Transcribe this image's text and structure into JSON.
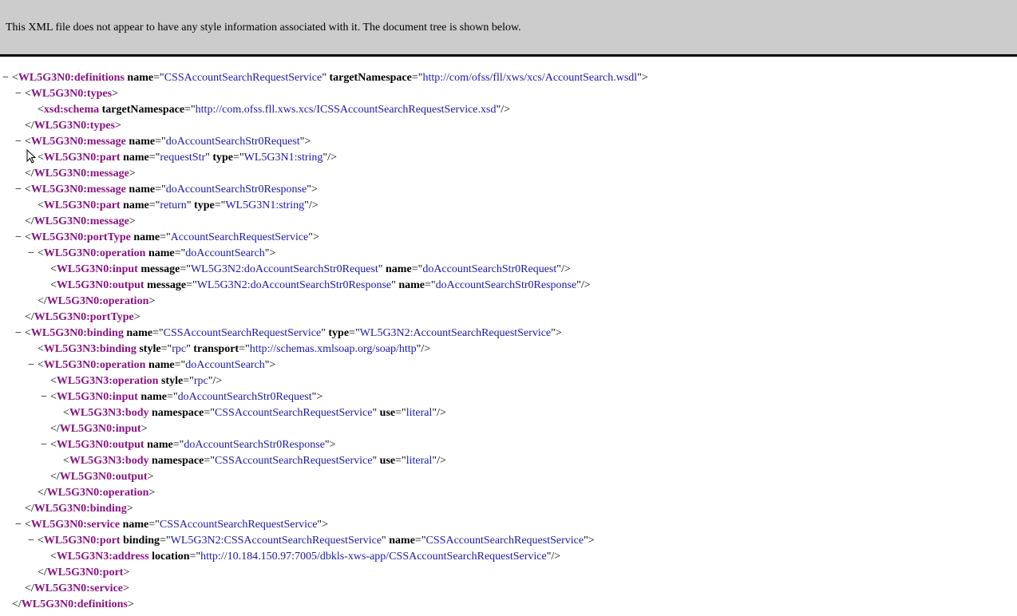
{
  "banner": {
    "message": "This XML file does not appear to have any style information associated with it. The document tree is shown below."
  },
  "colors": {
    "tag": "#881280",
    "attribute_value": "#1a1aa6",
    "banner_bg": "#cccccc"
  },
  "collapse_glyph": "−",
  "lines": [
    {
      "indent": 0,
      "toggle": true,
      "type": "open",
      "tag": "WL5G3N0:definitions",
      "attrs": [
        [
          "name",
          "CSSAccountSearchRequestService"
        ],
        [
          "targetNamespace",
          "http://com/ofss/fll/xws/xcs/AccountSearch.wsdl"
        ]
      ]
    },
    {
      "indent": 1,
      "toggle": true,
      "type": "open",
      "tag": "WL5G3N0:types",
      "attrs": []
    },
    {
      "indent": 2,
      "toggle": false,
      "type": "empty",
      "tag": "xsd:schema",
      "attrs": [
        [
          "targetNamespace",
          "http://com.ofss.fll.xws.xcs/ICSSAccountSearchRequestService.xsd"
        ]
      ]
    },
    {
      "indent": 1,
      "toggle": false,
      "type": "close",
      "tag": "WL5G3N0:types"
    },
    {
      "indent": 1,
      "toggle": true,
      "type": "open",
      "tag": "WL5G3N0:message",
      "attrs": [
        [
          "name",
          "doAccountSearchStr0Request"
        ]
      ]
    },
    {
      "indent": 2,
      "toggle": false,
      "type": "empty",
      "tag": "WL5G3N0:part",
      "attrs": [
        [
          "name",
          "requestStr"
        ],
        [
          "type",
          "WL5G3N1:string"
        ]
      ]
    },
    {
      "indent": 1,
      "toggle": false,
      "type": "close",
      "tag": "WL5G3N0:message"
    },
    {
      "indent": 1,
      "toggle": true,
      "type": "open",
      "tag": "WL5G3N0:message",
      "attrs": [
        [
          "name",
          "doAccountSearchStr0Response"
        ]
      ]
    },
    {
      "indent": 2,
      "toggle": false,
      "type": "empty",
      "tag": "WL5G3N0:part",
      "attrs": [
        [
          "name",
          "return"
        ],
        [
          "type",
          "WL5G3N1:string"
        ]
      ]
    },
    {
      "indent": 1,
      "toggle": false,
      "type": "close",
      "tag": "WL5G3N0:message"
    },
    {
      "indent": 1,
      "toggle": true,
      "type": "open",
      "tag": "WL5G3N0:portType",
      "attrs": [
        [
          "name",
          "AccountSearchRequestService"
        ]
      ]
    },
    {
      "indent": 2,
      "toggle": true,
      "type": "open",
      "tag": "WL5G3N0:operation",
      "attrs": [
        [
          "name",
          "doAccountSearch"
        ]
      ]
    },
    {
      "indent": 3,
      "toggle": false,
      "type": "empty",
      "tag": "WL5G3N0:input",
      "attrs": [
        [
          "message",
          "WL5G3N2:doAccountSearchStr0Request"
        ],
        [
          "name",
          "doAccountSearchStr0Request"
        ]
      ]
    },
    {
      "indent": 3,
      "toggle": false,
      "type": "empty",
      "tag": "WL5G3N0:output",
      "attrs": [
        [
          "message",
          "WL5G3N2:doAccountSearchStr0Response"
        ],
        [
          "name",
          "doAccountSearchStr0Response"
        ]
      ]
    },
    {
      "indent": 2,
      "toggle": false,
      "type": "close",
      "tag": "WL5G3N0:operation"
    },
    {
      "indent": 1,
      "toggle": false,
      "type": "close",
      "tag": "WL5G3N0:portType"
    },
    {
      "indent": 1,
      "toggle": true,
      "type": "open",
      "tag": "WL5G3N0:binding",
      "attrs": [
        [
          "name",
          "CSSAccountSearchRequestService"
        ],
        [
          "type",
          "WL5G3N2:AccountSearchRequestService"
        ]
      ]
    },
    {
      "indent": 2,
      "toggle": false,
      "type": "empty",
      "tag": "WL5G3N3:binding",
      "attrs": [
        [
          "style",
          "rpc"
        ],
        [
          "transport",
          "http://schemas.xmlsoap.org/soap/http"
        ]
      ]
    },
    {
      "indent": 2,
      "toggle": true,
      "type": "open",
      "tag": "WL5G3N0:operation",
      "attrs": [
        [
          "name",
          "doAccountSearch"
        ]
      ]
    },
    {
      "indent": 3,
      "toggle": false,
      "type": "empty",
      "tag": "WL5G3N3:operation",
      "attrs": [
        [
          "style",
          "rpc"
        ]
      ]
    },
    {
      "indent": 3,
      "toggle": true,
      "type": "open",
      "tag": "WL5G3N0:input",
      "attrs": [
        [
          "name",
          "doAccountSearchStr0Request"
        ]
      ]
    },
    {
      "indent": 4,
      "toggle": false,
      "type": "empty",
      "tag": "WL5G3N3:body",
      "attrs": [
        [
          "namespace",
          "CSSAccountSearchRequestService"
        ],
        [
          "use",
          "literal"
        ]
      ]
    },
    {
      "indent": 3,
      "toggle": false,
      "type": "close",
      "tag": "WL5G3N0:input"
    },
    {
      "indent": 3,
      "toggle": true,
      "type": "open",
      "tag": "WL5G3N0:output",
      "attrs": [
        [
          "name",
          "doAccountSearchStr0Response"
        ]
      ]
    },
    {
      "indent": 4,
      "toggle": false,
      "type": "empty",
      "tag": "WL5G3N3:body",
      "attrs": [
        [
          "namespace",
          "CSSAccountSearchRequestService"
        ],
        [
          "use",
          "literal"
        ]
      ]
    },
    {
      "indent": 3,
      "toggle": false,
      "type": "close",
      "tag": "WL5G3N0:output"
    },
    {
      "indent": 2,
      "toggle": false,
      "type": "close",
      "tag": "WL5G3N0:operation"
    },
    {
      "indent": 1,
      "toggle": false,
      "type": "close",
      "tag": "WL5G3N0:binding"
    },
    {
      "indent": 1,
      "toggle": true,
      "type": "open",
      "tag": "WL5G3N0:service",
      "attrs": [
        [
          "name",
          "CSSAccountSearchRequestService"
        ]
      ]
    },
    {
      "indent": 2,
      "toggle": true,
      "type": "open",
      "tag": "WL5G3N0:port",
      "attrs": [
        [
          "binding",
          "WL5G3N2:CSSAccountSearchRequestService"
        ],
        [
          "name",
          "CSSAccountSearchRequestService"
        ]
      ]
    },
    {
      "indent": 3,
      "toggle": false,
      "type": "empty",
      "tag": "WL5G3N3:address",
      "attrs": [
        [
          "location",
          "http://10.184.150.97:7005/dbkls-xws-app/CSSAccountSearchRequestService"
        ]
      ]
    },
    {
      "indent": 2,
      "toggle": false,
      "type": "close",
      "tag": "WL5G3N0:port"
    },
    {
      "indent": 1,
      "toggle": false,
      "type": "close",
      "tag": "WL5G3N0:service"
    },
    {
      "indent": 0,
      "toggle": false,
      "type": "close",
      "tag": "WL5G3N0:definitions"
    }
  ]
}
